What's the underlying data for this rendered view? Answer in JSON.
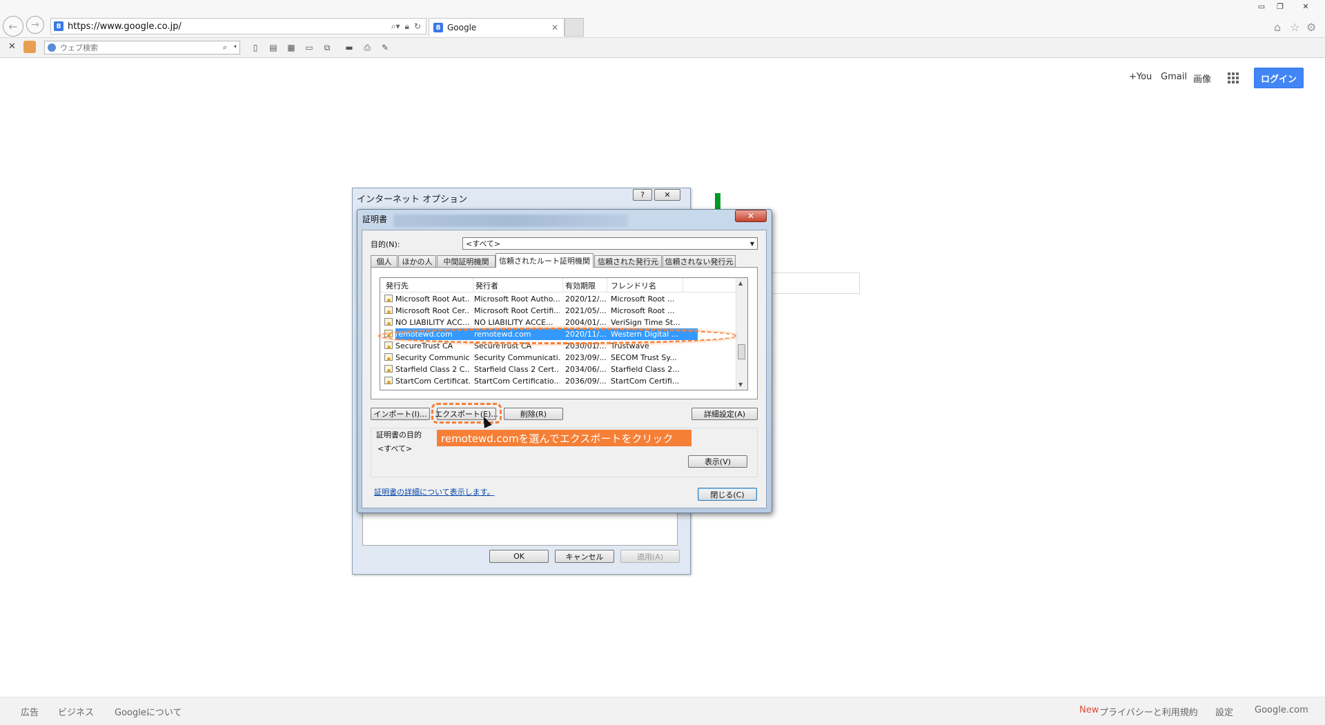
{
  "browser": {
    "url": "https://www.google.co.jp/",
    "tab_title": "Google",
    "tab_favicon": "8",
    "search_placeholder": "ウェブ検索"
  },
  "google": {
    "top_links": [
      "+You",
      "Gmail",
      "画像"
    ],
    "login_label": "ログイン",
    "footer_left": [
      "広告",
      "ビジネス",
      "Googleについて"
    ],
    "footer_new": "New",
    "footer_right": [
      "プライバシーと利用規約",
      "設定",
      "Google.com"
    ]
  },
  "internet_options": {
    "title": "インターネット オプション",
    "help_label": "?",
    "close_label": "✕",
    "ok_label": "OK",
    "cancel_label": "キャンセル",
    "apply_label": "適用(A)"
  },
  "cert_dialog": {
    "title": "証明書",
    "close_label": "✕",
    "purpose_label": "目的(N):",
    "purpose_value": "<すべて>",
    "tabs": [
      "個人",
      "ほかの人",
      "中間証明機関",
      "信頼されたルート証明機関",
      "信頼された発行元",
      "信頼されない発行元"
    ],
    "active_tab": "信頼されたルート証明機関",
    "columns": [
      "発行先",
      "発行者",
      "有効期限",
      "フレンドリ名"
    ],
    "rows": [
      [
        "Microsoft Root Aut...",
        "Microsoft Root Autho...",
        "2020/12/...",
        "Microsoft Root ..."
      ],
      [
        "Microsoft Root Cer...",
        "Microsoft Root Certifi...",
        "2021/05/...",
        "Microsoft Root ..."
      ],
      [
        "NO LIABILITY ACC...",
        "NO LIABILITY ACCE...",
        "2004/01/...",
        "VeriSign Time St..."
      ],
      [
        "remotewd.com",
        "remotewd.com",
        "2020/11/...",
        "Western Digital ..."
      ],
      [
        "SecureTrust CA",
        "SecureTrust CA",
        "2030/01/...",
        "Trustwave"
      ],
      [
        "Security Communic...",
        "Security Communicati...",
        "2023/09/...",
        "SECOM Trust Sy..."
      ],
      [
        "Starfield Class 2 C...",
        "Starfield Class 2 Cert...",
        "2034/06/...",
        "Starfield Class 2..."
      ],
      [
        "StartCom Certificat...",
        "StartCom Certificatio...",
        "2036/09/...",
        "StartCom Certifi..."
      ]
    ],
    "selected_row": 3,
    "import_label": "インポート(I)...",
    "export_label": "エクスポート(E)...",
    "delete_label": "削除(R)",
    "advanced_label": "詳細設定(A)",
    "cert_purpose_heading": "証明書の目的",
    "cert_purpose_value": "<すべて>",
    "view_label": "表示(V)",
    "details_link": "証明書の詳細について表示します。",
    "close_button": "閉じる(C)"
  },
  "annotation": {
    "note": "remotewd.comを選んでエクスポートをクリック",
    "accent": "#f57f36"
  }
}
